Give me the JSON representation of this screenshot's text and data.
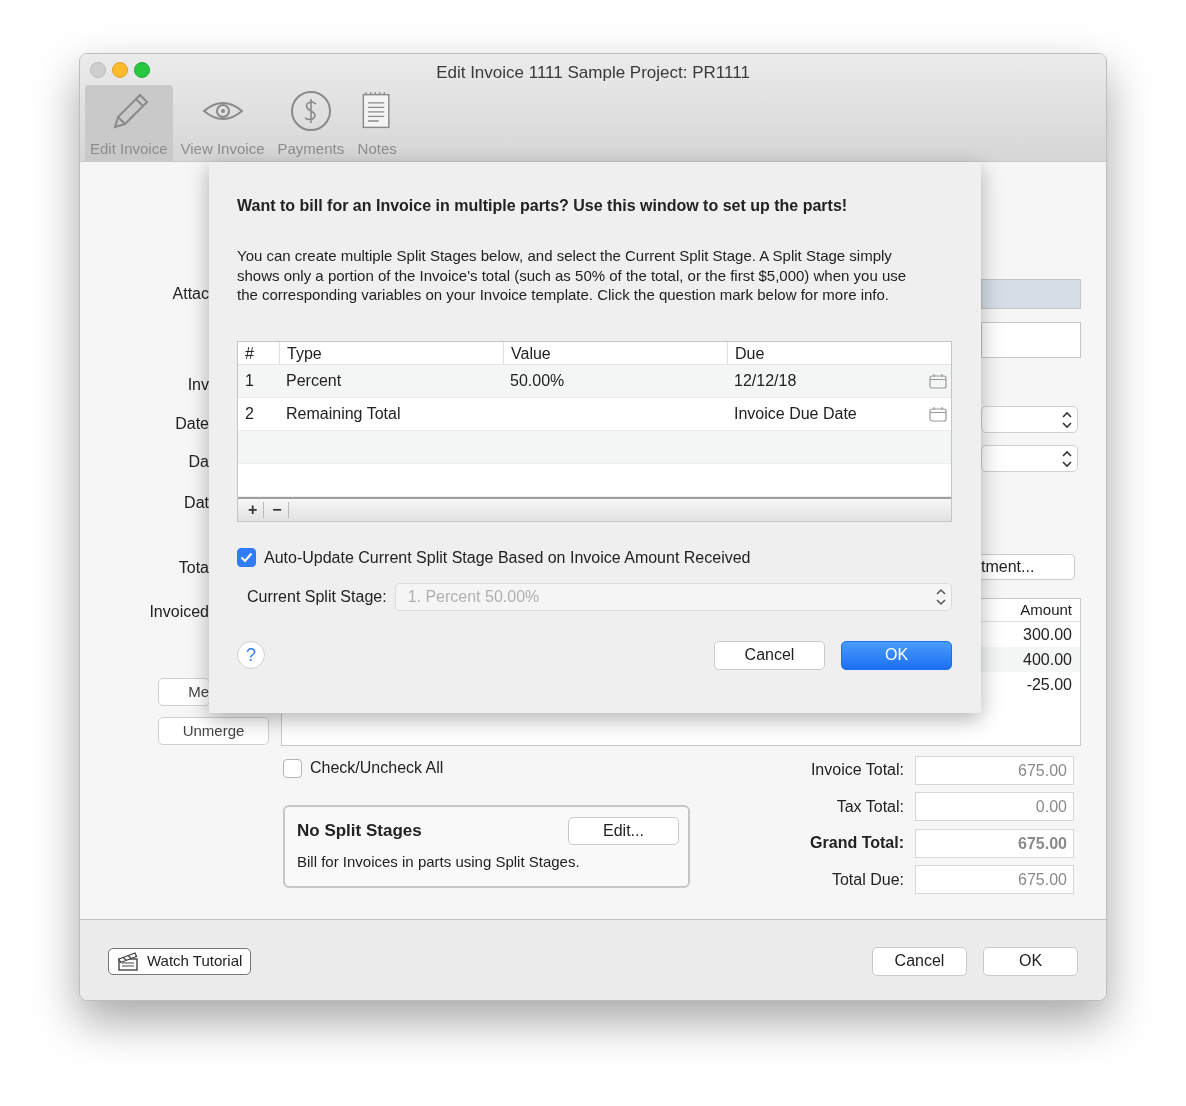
{
  "window": {
    "title": "Edit Invoice 1111 Sample Project: PR1111"
  },
  "toolbar": [
    {
      "label": "Edit Invoice",
      "selected": true
    },
    {
      "label": "View Invoice",
      "selected": false
    },
    {
      "label": "Payments",
      "selected": false
    },
    {
      "label": "Notes",
      "selected": false
    }
  ],
  "form_labels": [
    "Attac",
    "Inv",
    "Date",
    "Da",
    "Dat",
    "Tota",
    "Invoiced"
  ],
  "side_buttons": [
    "Me",
    "Unmerge"
  ],
  "right_fields": [
    {
      "kind": "highlighted"
    },
    {
      "kind": "text"
    },
    {
      "kind": "select"
    },
    {
      "kind": "select"
    }
  ],
  "adjustment_button": "tment...",
  "amounts": {
    "column": "Amount",
    "rows": [
      "300.00",
      "400.00",
      "-25.00"
    ]
  },
  "check_all": {
    "label": "Check/Uncheck All",
    "checked": false
  },
  "split_stages": {
    "title": "No Split Stages",
    "button": "Edit...",
    "description": "Bill for Invoices in parts using Split Stages."
  },
  "totals": [
    {
      "label": "Invoice Total:",
      "value": "675.00",
      "bold": false
    },
    {
      "label": "Tax Total:",
      "value": "0.00",
      "bold": false
    },
    {
      "label": "Grand Total:",
      "value": "675.00",
      "bold": true
    },
    {
      "label": "Total Due:",
      "value": "675.00",
      "bold": false
    }
  ],
  "footer": {
    "tutorial": "Watch Tutorial",
    "buttons": [
      "Cancel",
      "OK"
    ]
  },
  "sheet": {
    "heading": "Want to bill for an Invoice in multiple parts? Use this window to set up the parts!",
    "text": "You can create multiple Split Stages below, and select the Current Split Stage. A Split Stage simply shows only a portion of the Invoice's total (such as 50% of the total, or the first $5,000) when you use the corresponding variables on your Invoice template. Click the question mark below for more info.",
    "table": {
      "columns": [
        "#",
        "Type",
        "Value",
        "Due"
      ],
      "rows": [
        {
          "number": "1",
          "type": "Percent",
          "value": "50.00%",
          "due": "12/12/18"
        },
        {
          "number": "2",
          "type": "Remaining Total",
          "value": "",
          "due": "Invoice Due Date"
        }
      ],
      "tools": [
        "+",
        "−"
      ]
    },
    "auto_update": {
      "label": "Auto-Update Current Split Stage Based on Invoice Amount Received",
      "checked": true
    },
    "current_stage": {
      "label": "Current Split Stage:",
      "value": "1. Percent 50.00%",
      "disabled": true
    },
    "help": "?",
    "buttons": [
      {
        "label": "Cancel",
        "default": false
      },
      {
        "label": "OK",
        "default": true
      }
    ]
  }
}
